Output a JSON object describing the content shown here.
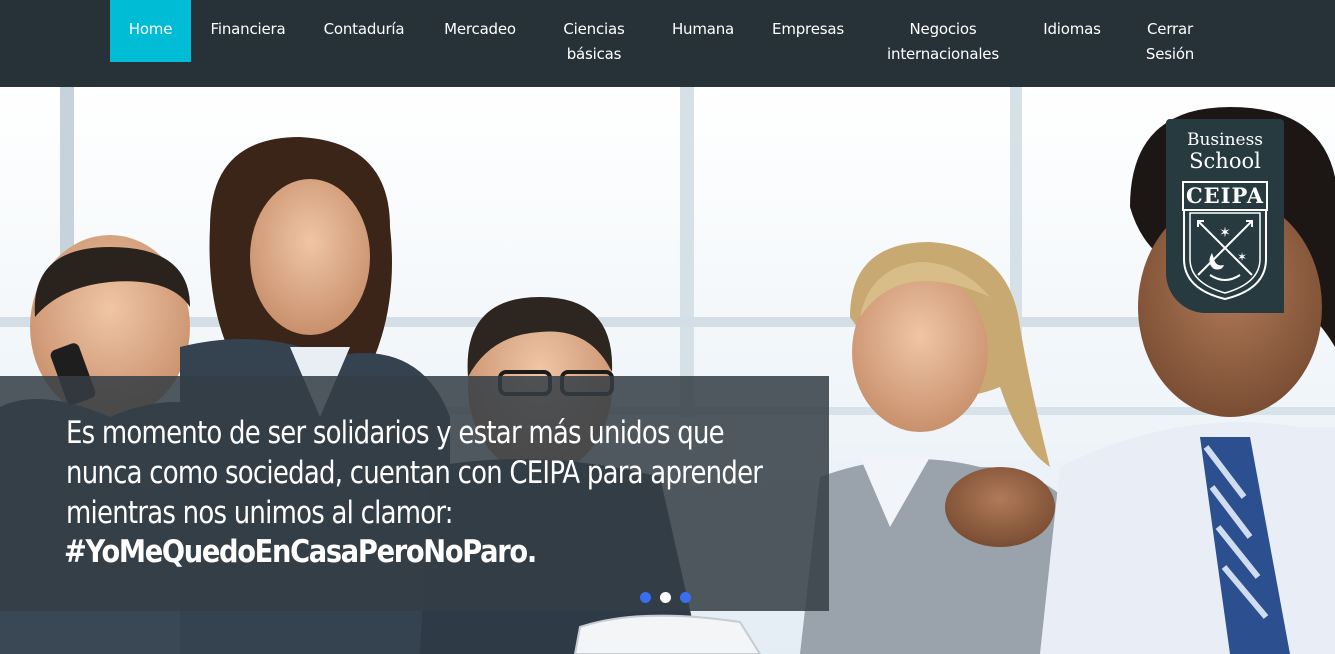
{
  "nav": {
    "items": [
      {
        "label": "Home",
        "active": true
      },
      {
        "label": "Financiera"
      },
      {
        "label": "Contaduría"
      },
      {
        "label": "Mercadeo"
      },
      {
        "label": "Ciencias\nbásicas"
      },
      {
        "label": "Humana"
      },
      {
        "label": "Empresas"
      },
      {
        "label": "Negocios\ninternacionales"
      },
      {
        "label": "Idiomas"
      },
      {
        "label": "Cerrar\nSesión"
      }
    ]
  },
  "hero": {
    "caption": "Es momento de ser solidarios y estar más unidos que nunca como sociedad, cuentan con CEIPA para aprender mientras nos unimos al clamor:",
    "hashtag": "#YoMeQuedoEnCasaPeroNoParo.",
    "carousel_active_index": 1,
    "carousel_count": 3
  },
  "logo": {
    "line1": "Business",
    "line2": "School",
    "name": "CEIPA"
  },
  "colors": {
    "nav_bg": "#263238",
    "nav_active": "#00bcd4",
    "caption_bg": "#343e45",
    "dot": "#3b6df0"
  }
}
